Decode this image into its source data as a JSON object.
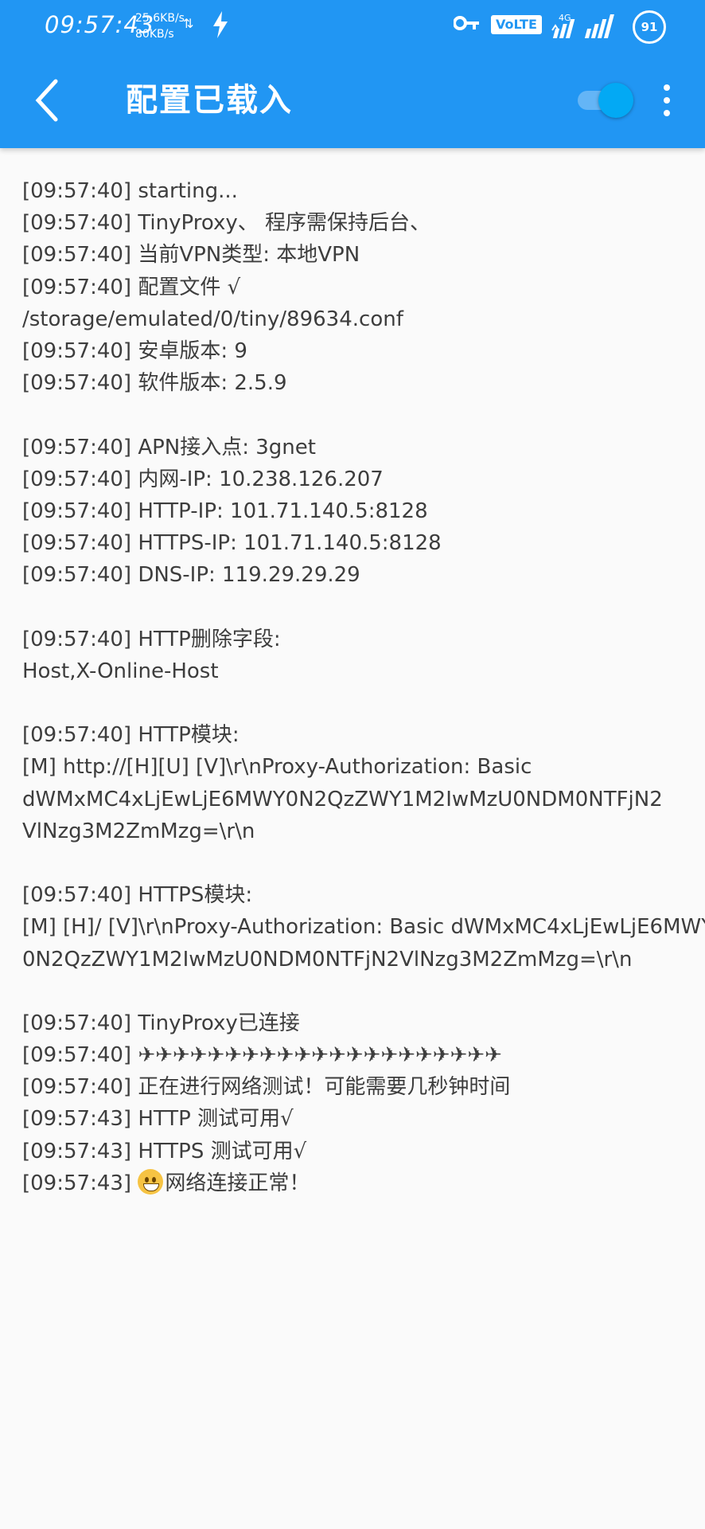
{
  "status_bar": {
    "time": "09:57:43",
    "upload_speed": "25.6KB/s",
    "download_speed": "80KB/s",
    "carrier_watermark": "",
    "volte_label": "VoLTE",
    "network_type": "4G",
    "battery_level": "91"
  },
  "app_bar": {
    "title": "配置已载入",
    "toggle_on": true
  },
  "log": {
    "lines": [
      "[09:57:40] starting...",
      "[09:57:40] TinyProxy、 程序需保持后台、",
      "[09:57:40] 当前VPN类型: 本地VPN",
      "[09:57:40] 配置文件 √",
      "/storage/emulated/0/tiny/89634.conf",
      "[09:57:40] 安卓版本: 9",
      "[09:57:40] 软件版本: 2.5.9",
      "",
      "[09:57:40] APN接入点: 3gnet",
      "[09:57:40] 内网-IP: 10.238.126.207",
      "[09:57:40] HTTP-IP: 101.71.140.5:8128",
      "[09:57:40] HTTPS-IP: 101.71.140.5:8128",
      "[09:57:40] DNS-IP: 119.29.29.29",
      "",
      "[09:57:40] HTTP删除字段:",
      "Host,X-Online-Host",
      "",
      "[09:57:40] HTTP模块:",
      "[M] http://[H][U] [V]\\r\\nProxy-Authorization: Basic",
      "dWMxMC4xLjEwLjE6MWY0N2QzZWY1M2IwMzU0NDM0NTFjN2",
      "VlNzg3M2ZmMzg=\\r\\n",
      "",
      "[09:57:40] HTTPS模块:",
      "[M] [H]/ [V]\\r\\nProxy-Authorization: Basic dWMxMC4xLjEwLjE6MWY",
      "0N2QzZWY1M2IwMzU0NDM0NTFjN2VlNzg3M2ZmMzg=\\r\\n",
      "",
      "[09:57:40] TinyProxy已连接",
      "[09:57:40] ✈✈✈✈✈✈✈✈✈✈✈✈✈✈✈✈✈✈✈✈✈",
      "[09:57:40] 正在进行网络测试！可能需要几秒钟时间",
      "[09:57:43] HTTP 测试可用√",
      "[09:57:43] HTTPS 测试可用√"
    ],
    "last_line_prefix": "[09:57:43] ",
    "last_line_text": "网络连接正常！"
  },
  "colors": {
    "app_bar": "#2196f3",
    "toggle_thumb": "#03a9f4",
    "log_text": "#3d3d3d",
    "background": "#fafafa"
  }
}
